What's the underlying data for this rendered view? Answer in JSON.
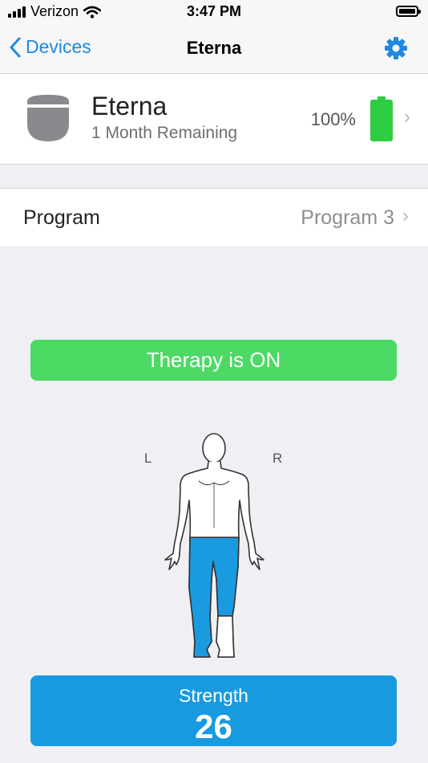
{
  "status_bar": {
    "carrier": "Verizon",
    "time": "3:47 PM"
  },
  "nav": {
    "back_label": "Devices",
    "title": "Eterna",
    "settings_icon": "gear-icon"
  },
  "device": {
    "name": "Eterna",
    "remaining": "1 Month Remaining",
    "battery_percent": "100%",
    "battery_level": 1.0,
    "battery_color": "#2ecc40"
  },
  "program": {
    "label": "Program",
    "value": "Program 3"
  },
  "therapy": {
    "label": "Therapy is ON",
    "color": "#4cd964"
  },
  "body_map": {
    "left_label": "L",
    "right_label": "R",
    "highlight_color": "#1a9be0",
    "highlighted_regions": [
      "pelvis",
      "left-leg",
      "right-thigh"
    ]
  },
  "strength": {
    "label": "Strength",
    "value": "26",
    "color": "#189ae0"
  },
  "accent_color": "#1e88e5"
}
